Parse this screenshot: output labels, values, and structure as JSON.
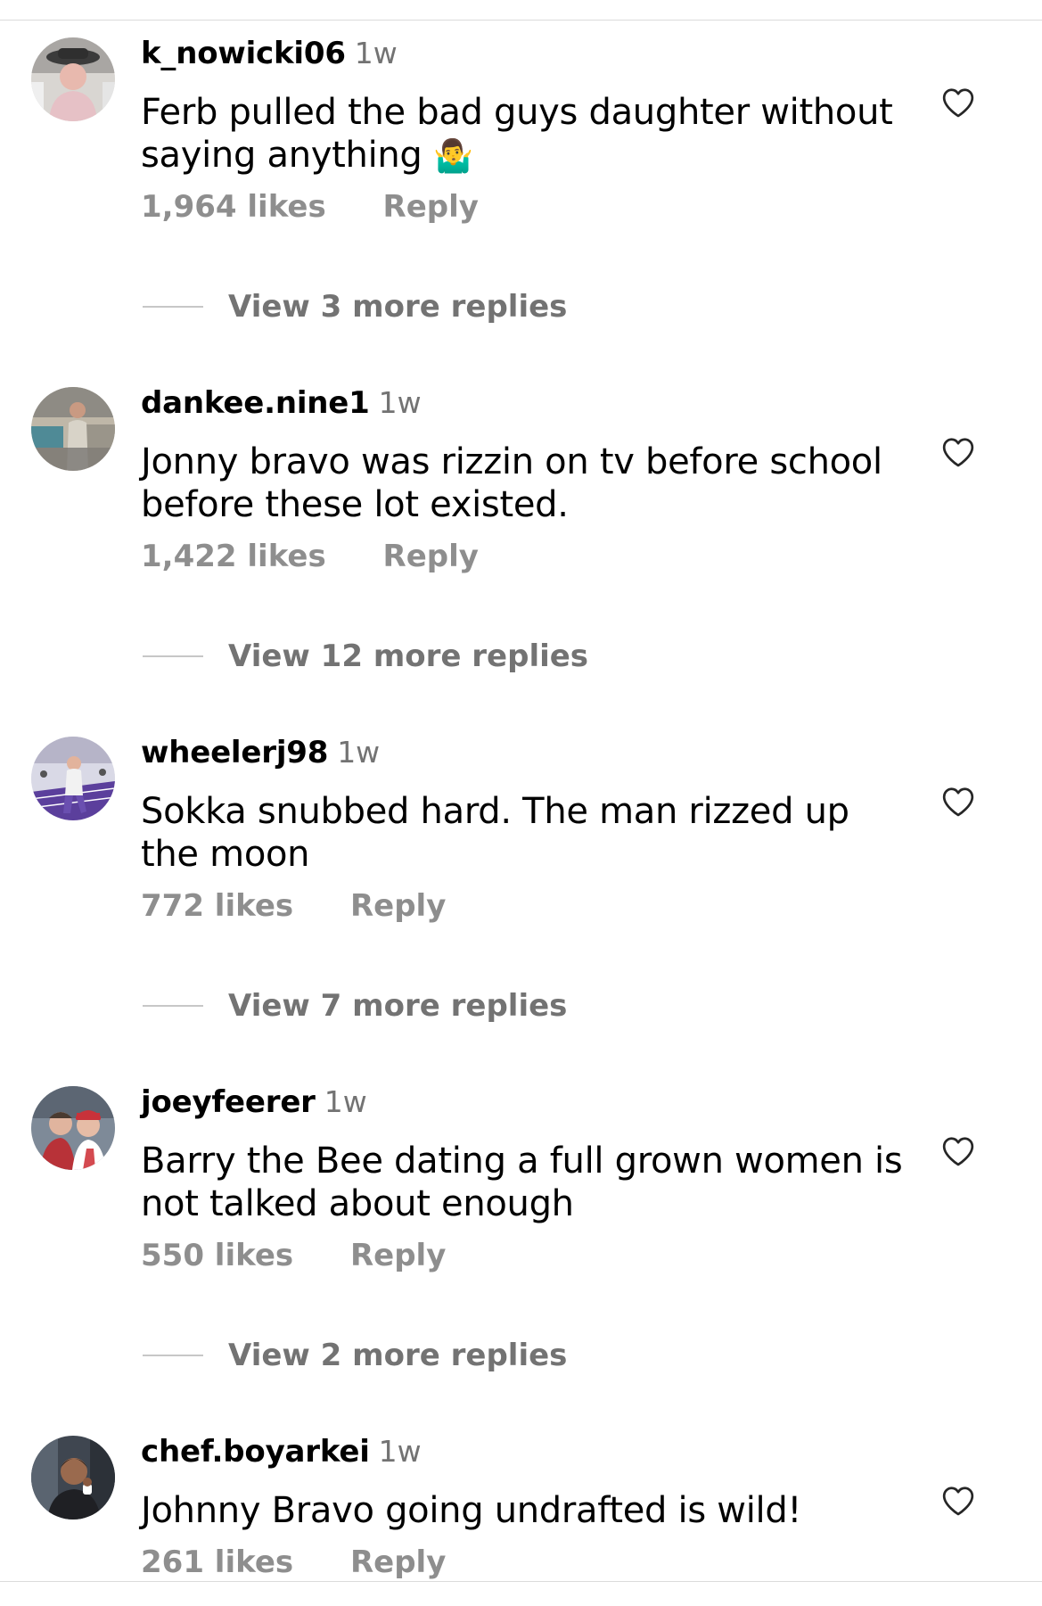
{
  "comments": [
    {
      "username": "k_nowicki06",
      "time": "1w",
      "text": "Ferb pulled the bad guys daughter without saying anything",
      "emoji": "🤷‍♂️",
      "likes": "1,964 likes",
      "reply_label": "Reply",
      "view_replies": "View 3 more replies"
    },
    {
      "username": "dankee.nine1",
      "time": "1w",
      "text": "Jonny bravo was rizzin on tv before school before these lot existed.",
      "emoji": "",
      "likes": "1,422 likes",
      "reply_label": "Reply",
      "view_replies": "View 12 more replies"
    },
    {
      "username": "wheelerj98",
      "time": "1w",
      "text": "Sokka snubbed hard. The man rizzed up the moon",
      "emoji": "",
      "likes": "772 likes",
      "reply_label": "Reply",
      "view_replies": "View 7 more replies"
    },
    {
      "username": "joeyfeerer",
      "time": "1w",
      "text": "Barry the Bee dating a full grown women is not talked about enough",
      "emoji": "",
      "likes": "550 likes",
      "reply_label": "Reply",
      "view_replies": "View 2 more replies"
    },
    {
      "username": "chef.boyarkei",
      "time": "1w",
      "text": "Johnny Bravo going undrafted is wild!",
      "emoji": "",
      "likes": "261 likes",
      "reply_label": "Reply",
      "view_replies": ""
    }
  ],
  "icons": {
    "like": "heart-outline-icon",
    "avatar": "avatar"
  },
  "colors": {
    "background": "#ffffff",
    "primary_text": "#000000",
    "secondary_text": "#737373",
    "muted_text": "#8e8e8e",
    "divider": "#dbdbdb"
  }
}
